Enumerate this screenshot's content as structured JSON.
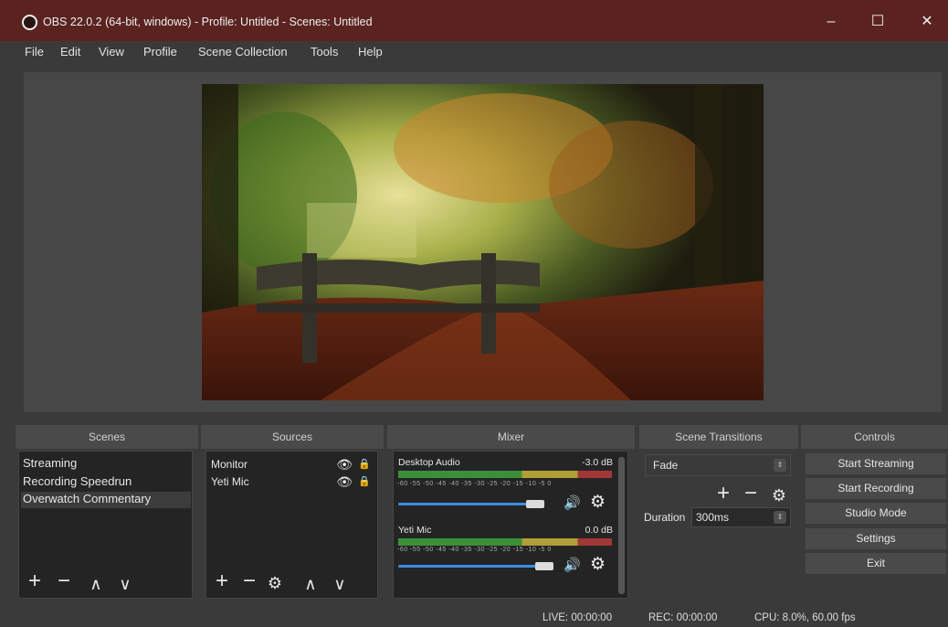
{
  "window": {
    "title": "OBS 22.0.2 (64-bit, windows) - Profile: Untitled - Scenes: Untitled",
    "minimize_glyph": "–",
    "maximize_glyph": "☐",
    "close_glyph": "✕"
  },
  "menu": [
    "File",
    "Edit",
    "View",
    "Profile",
    "Scene Collection",
    "Tools",
    "Help"
  ],
  "docks": {
    "scenes": {
      "title": "Scenes",
      "items": [
        "Streaming",
        "Recording Speedrun",
        "Overwatch Commentary"
      ],
      "selected_index": 2
    },
    "sources": {
      "title": "Sources",
      "items": [
        {
          "label": "Monitor",
          "visible": true,
          "locked": true
        },
        {
          "label": "Yeti Mic",
          "visible": true,
          "locked": true
        }
      ]
    },
    "mixer": {
      "title": "Mixer",
      "tick_labels": "-60 -55 -50 -45 -40 -35 -30 -25 -20 -15 -10 -5 0",
      "channels": [
        {
          "name": "Desktop Audio",
          "db": "-3.0 dB",
          "level": 0.94
        },
        {
          "name": "Yeti Mic",
          "db": "0.0 dB",
          "level": 1.0
        }
      ]
    },
    "transitions": {
      "title": "Scene Transitions",
      "selected": "Fade",
      "duration_label": "Duration",
      "duration_value": "300ms"
    },
    "controls": {
      "title": "Controls",
      "buttons": [
        "Start Streaming",
        "Start Recording",
        "Studio Mode",
        "Settings",
        "Exit"
      ]
    }
  },
  "toolbar": {
    "add": "+",
    "remove": "−",
    "up": "∧",
    "down": "∨",
    "settings": "⚙"
  },
  "status": {
    "live": "LIVE: 00:00:00",
    "rec": "REC: 00:00:00",
    "cpu": "CPU: 8.0%, 60.00 fps"
  },
  "colors": {
    "titlebar": "#5a231f",
    "panel": "#3a3a3a",
    "accent_slider": "#3a8fe0",
    "meter_green": "#3fa33a",
    "meter_yellow": "#c8b53a",
    "meter_red": "#b73a3a"
  }
}
